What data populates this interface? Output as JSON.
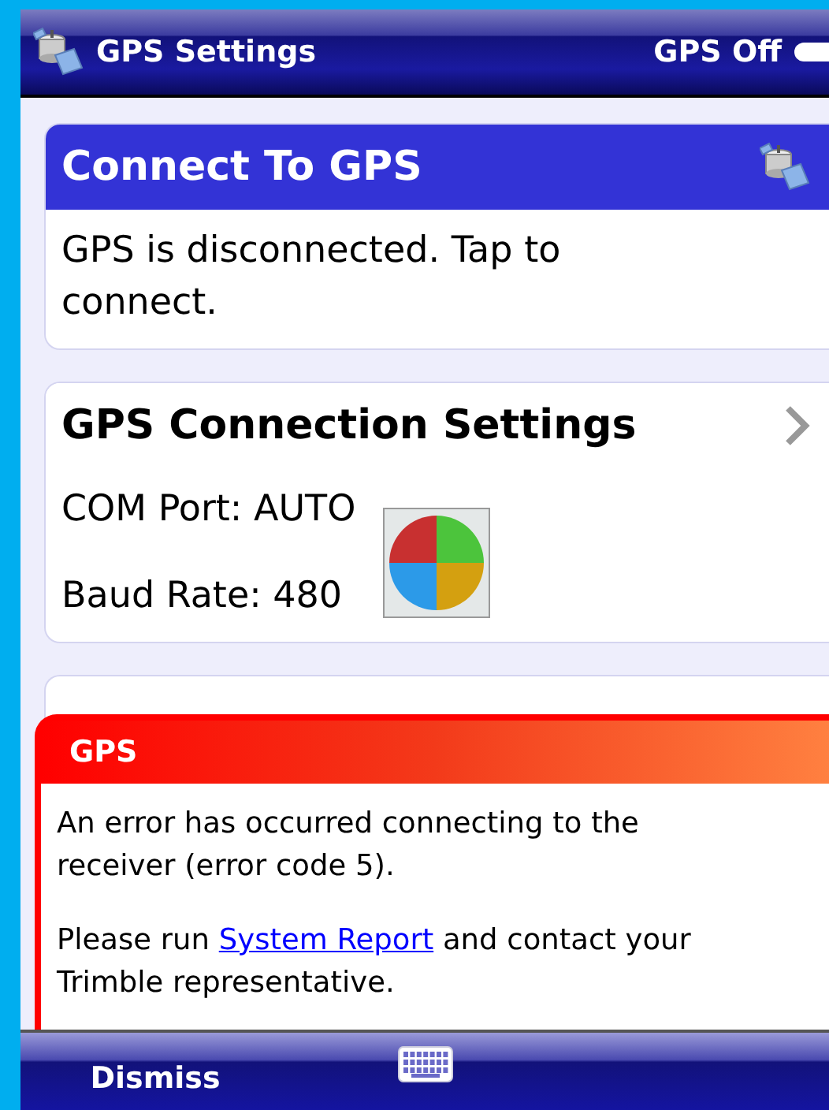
{
  "title_bar": {
    "title": "GPS Settings",
    "status": "GPS Off"
  },
  "cards": [
    {
      "kind": "header",
      "title": "Connect To GPS",
      "lines": [
        "GPS is disconnected. Tap to connect."
      ]
    },
    {
      "kind": "nav",
      "title": "GPS Connection Settings",
      "lines": [
        "COM Port: AUTO",
        "Baud Rate: 480"
      ]
    },
    {
      "kind": "plain"
    }
  ],
  "busy": true,
  "dialog": {
    "title": "GPS",
    "message": "An error has occurred connecting to the receiver (error code 5).",
    "report_before": "Please run",
    "report_link": "System Report",
    "report_after": "and contact your Trimble representative."
  },
  "bottom_bar": {
    "left": "Dismiss"
  }
}
